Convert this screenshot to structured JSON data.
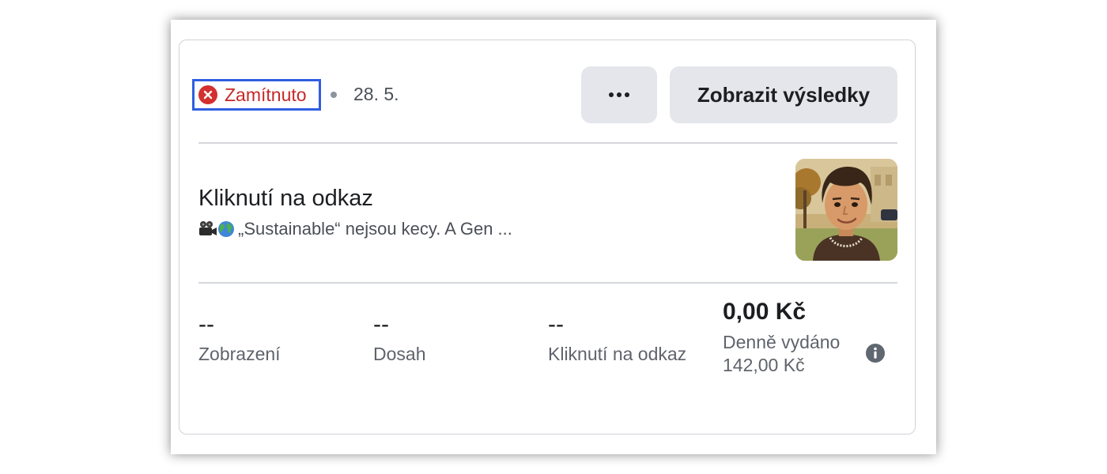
{
  "status": {
    "label": "Zamítnuto",
    "icon": "error-circle-icon",
    "color": "#c62828"
  },
  "date": "28. 5.",
  "actions": {
    "more_icon": "more-horizontal-icon",
    "results_label": "Zobrazit výsledky"
  },
  "ad": {
    "title": "Kliknutí na odkaz",
    "description": "„Sustainable“ nejsou kecy. A Gen ...",
    "description_icons": [
      "movie-camera-icon",
      "globe-icon"
    ],
    "thumbnail_icon": "illustrated-portrait-thumbnail"
  },
  "metrics": [
    {
      "value": "--",
      "label": "Zobrazení"
    },
    {
      "value": "--",
      "label": "Dosah"
    },
    {
      "value": "--",
      "label": "Kliknutí na odkaz"
    }
  ],
  "spend": {
    "value": "0,00 Kč",
    "label": "Denně vydáno",
    "amount": "142,00 Kč",
    "info_icon": "info-icon"
  },
  "colors": {
    "highlight_border": "#2f5ee0",
    "button_bg": "#e4e6eb"
  }
}
